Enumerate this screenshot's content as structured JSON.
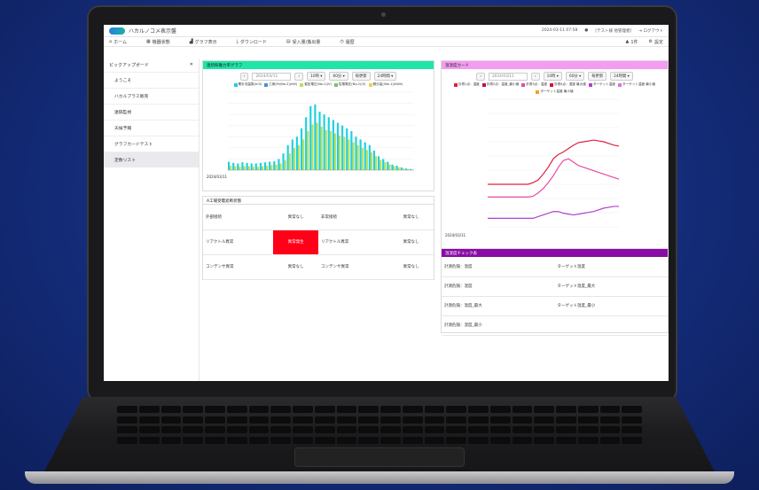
{
  "app": {
    "title": "ハカルノコメ表示盤",
    "datetime": "2024-03-11 07:58",
    "user": "[テスト様 他管理者]",
    "logout": "ログアウト"
  },
  "menu": {
    "home": "ホーム",
    "equipment": "機器状態",
    "graph": "グラフ表示",
    "download": "ダウンロード",
    "inout": "受入量/搬出量",
    "history": "履歴",
    "alert": "1件",
    "settings": "設定"
  },
  "sidebar": {
    "title": "ピックアップボード",
    "items": [
      "ようこそ",
      "ハカルプラス販売",
      "遠隔監視",
      "天候予報",
      "グラフカードテスト",
      "定数リスト"
    ]
  },
  "panel1": {
    "title": "連続稼働力率グラフ",
    "date": "2024/03/11",
    "interval": "10時 ▾",
    "span": "60分 ▾",
    "update": "毎更新",
    "range": "24時間 ▾",
    "legend": [
      "累計流量数(m3)",
      "乙側(Fe/No.2)(kW)",
      "暫定電圧(No.1)(V)",
      "従電電圧(No.2)(V)",
      "積分量(/No.1)(kWh)"
    ],
    "foot_date": "2024/03/11",
    "chart_data": {
      "type": "bar",
      "series": [
        {
          "name": "累計流量数(m3)",
          "values": [
            15,
            13,
            12,
            14,
            13,
            12,
            12,
            13,
            14,
            15,
            16,
            20,
            30,
            45,
            55,
            60,
            75,
            95,
            115,
            118,
            105,
            100,
            95,
            90,
            85,
            80,
            75,
            70,
            60,
            55,
            50,
            45,
            35,
            25,
            20,
            15,
            10,
            8,
            5,
            3,
            2
          ]
        },
        {
          "name": "乙側(Fe/No.2)(kW)",
          "values": [
            8,
            7,
            6,
            7,
            7,
            6,
            6,
            7,
            8,
            9,
            10,
            12,
            18,
            30,
            40,
            45,
            55,
            70,
            82,
            85,
            78,
            72,
            70,
            66,
            62,
            60,
            55,
            50,
            45,
            40,
            36,
            32,
            25,
            18,
            14,
            10,
            7,
            5,
            3,
            2,
            1
          ]
        }
      ],
      "ylim": [
        0,
        140
      ]
    }
  },
  "panel2": {
    "title": "温湿度カード",
    "date": "2024/03/11",
    "interval": "10時 ▾",
    "span": "60分 ▾",
    "update": "毎更新",
    "range": "24時間 ▾",
    "legend": [
      "計測1点：温度",
      "計測2点：温度_最小値",
      "計測3点：温度",
      "計測4点：湿度 最大値",
      "ターゲット温度",
      "ターゲット温度 最小値",
      "ターゲット温度 最小値"
    ],
    "foot_date": "2024/03/11",
    "chart_data": {
      "type": "line",
      "series": [
        {
          "name": "計測1点：温度",
          "values": [
            50,
            50,
            50,
            50,
            50,
            50,
            50,
            50,
            50,
            52,
            55,
            62,
            70,
            80,
            85,
            88,
            92,
            96,
            99,
            100,
            101,
            102,
            101,
            100,
            98,
            96,
            95
          ]
        },
        {
          "name": "計測3点：温度",
          "values": [
            35,
            35,
            35,
            35,
            35,
            35,
            35,
            35,
            35,
            36,
            40,
            45,
            52,
            60,
            70,
            78,
            80,
            76,
            72,
            70,
            68,
            66,
            64,
            62,
            60,
            58,
            56
          ]
        },
        {
          "name": "ターゲット温度",
          "values": [
            10,
            10,
            10,
            10,
            10,
            10,
            10,
            10,
            10,
            10,
            12,
            14,
            16,
            18,
            18,
            16,
            15,
            14,
            15,
            16,
            17,
            18,
            20,
            22,
            23,
            24,
            24
          ]
        }
      ],
      "ylim": [
        0,
        150
      ]
    }
  },
  "panel3": {
    "title": "A工場受電遮断状態",
    "rows": [
      [
        "外部接続",
        "異常なし",
        "非常接続",
        "異常なし"
      ],
      [
        "リアクトル異常",
        "異常発生",
        "リアクトル異常",
        "異常なし"
      ],
      [
        "コンデンサ異常",
        "異常なし",
        "コンデンサ異常",
        "異常なし"
      ]
    ]
  },
  "panel4": {
    "title": "温湿度チェック表",
    "rows": [
      [
        "計測危険：温度",
        "ターゲット温度"
      ],
      [
        "計測危険：湿度",
        "ターゲット温度_最大"
      ],
      [
        "計測危険：温度_最大",
        "ターゲット温度_最小"
      ],
      [
        "計測危険：湿度_最小",
        ""
      ]
    ]
  }
}
